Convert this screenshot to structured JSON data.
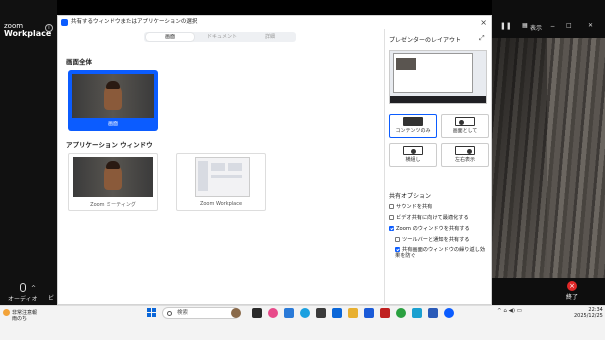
{
  "zoom": {
    "logo_top": "zoom",
    "logo_bottom": "Workplace",
    "info": "i",
    "mic_label": "オーディオ",
    "mic_caret": "^",
    "video_label": "ビ",
    "end_label": "終了",
    "end_x": "×",
    "top_right_label": "表示"
  },
  "dialog": {
    "title": "共有するウィンドウまたはアプリケーションの選択",
    "close": "×",
    "tabs": [
      "画面",
      "ドキュメント",
      "詳細"
    ],
    "section_screen": "画面全体",
    "screen_label": "画面",
    "section_apps": "アプリケーション ウィンドウ",
    "apps": [
      "Zoom ミーティング",
      "Zoom Workplace"
    ]
  },
  "presenter": {
    "title": "プレゼンターのレイアウト",
    "expand": "⤢",
    "layouts": [
      "コンテンツのみ",
      "画面として",
      "横組し",
      "左右表示"
    ],
    "options_title": "共有オプション",
    "options": [
      {
        "label": "サウンドを共有",
        "checked": false
      },
      {
        "label": "ビデオ共有に向けて最適化する",
        "checked": false
      },
      {
        "label": "Zoom のウィンドウを共有する",
        "checked": true
      },
      {
        "label": "ツールバーと通知を共有する",
        "checked": false
      },
      {
        "label": "共有画面のウィンドウの繰り返し効果を防ぐ",
        "checked": true
      }
    ]
  },
  "taskbar": {
    "weather_title": "非常注意報",
    "weather_sub": "雨のち",
    "search_placeholder": "検索",
    "tray": "^  ⌂  ◀)  ▭",
    "time": "22:34",
    "date": "2025/12/25"
  },
  "colors": {
    "accent": "#0b5cff",
    "end": "#e02828"
  }
}
